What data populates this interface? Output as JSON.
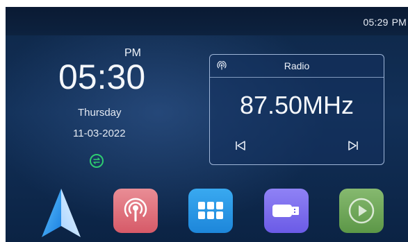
{
  "status_bar": {
    "time": "05:29",
    "ampm": "PM"
  },
  "clock": {
    "ampm": "PM",
    "time": "05:30",
    "day": "Thursday",
    "date": "11-03-2022"
  },
  "radio": {
    "title": "Radio",
    "frequency": "87.50MHz"
  },
  "dock": {
    "apps": [
      {
        "name": "navigation",
        "icon": "navigation-arrow-icon"
      },
      {
        "name": "radio",
        "icon": "radio-broadcast-icon"
      },
      {
        "name": "apps",
        "icon": "grid-icon"
      },
      {
        "name": "usb",
        "icon": "usb-drive-icon"
      },
      {
        "name": "media",
        "icon": "play-icon"
      }
    ]
  },
  "colors": {
    "accent_green": "#2ecc71",
    "radio_app": "#d65a68",
    "apps_app": "#1d86da",
    "usb_app": "#6b5be6",
    "media_app": "#5c9747"
  }
}
